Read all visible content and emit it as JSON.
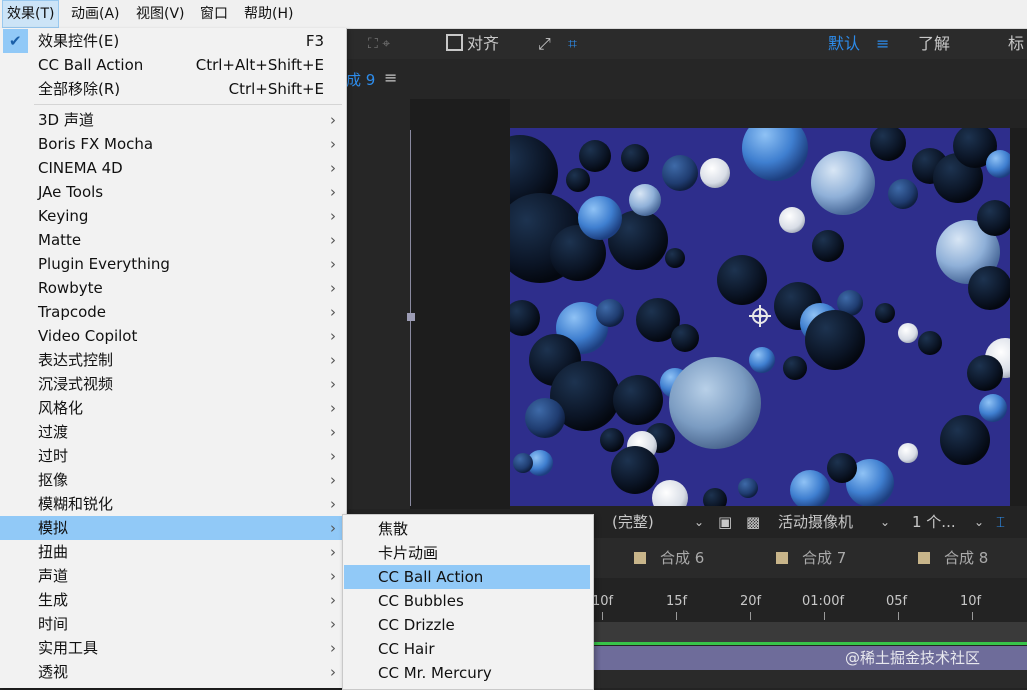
{
  "menubar": {
    "items": [
      "效果(T)",
      "动画(A)",
      "视图(V)",
      "窗口",
      "帮助(H)"
    ]
  },
  "toolbar": {
    "align": "对齐",
    "workspace_default": "默认",
    "learn": "了解",
    "cut_label": "标"
  },
  "comp_tab": "成 9",
  "effect_menu": {
    "top": [
      {
        "label": "效果控件(E)",
        "shortcut": "F3",
        "checked": true
      },
      {
        "label": "CC Ball Action",
        "shortcut": "Ctrl+Alt+Shift+E"
      },
      {
        "label": "全部移除(R)",
        "shortcut": "Ctrl+Shift+E"
      }
    ],
    "categories": [
      "3D 声道",
      "Boris FX Mocha",
      "CINEMA 4D",
      "JAe Tools",
      "Keying",
      "Matte",
      "Plugin Everything",
      "Rowbyte",
      "Trapcode",
      "Video Copilot",
      "表达式控制",
      "沉浸式视频",
      "风格化",
      "过渡",
      "过时",
      "抠像",
      "模糊和锐化",
      "模拟",
      "扭曲",
      "声道",
      "生成",
      "时间",
      "实用工具",
      "透视"
    ],
    "highlighted": "模拟",
    "arrow": "›"
  },
  "simulate_submenu": {
    "items": [
      "焦散",
      "卡片动画",
      "CC Ball Action",
      "CC Bubbles",
      "CC Drizzle",
      "CC Hair",
      "CC Mr. Mercury"
    ],
    "highlighted": "CC Ball Action"
  },
  "viewer_bar": {
    "resolution": "(完整)",
    "camera": "活动摄像机",
    "views": "1 个..."
  },
  "timeline_tabs": [
    "合成 6",
    "合成 7",
    "合成 8"
  ],
  "ruler_ticks": [
    "10f",
    "15f",
    "20f",
    "01:00f",
    "05f",
    "10f"
  ],
  "watermark": "@稀土掘金技术社区",
  "colors": {
    "viewer_bg": "#2e2e8c",
    "menu_highlight": "#91c9f7",
    "accent_blue": "#2d8ceb",
    "timeline_green": "#37c449"
  }
}
